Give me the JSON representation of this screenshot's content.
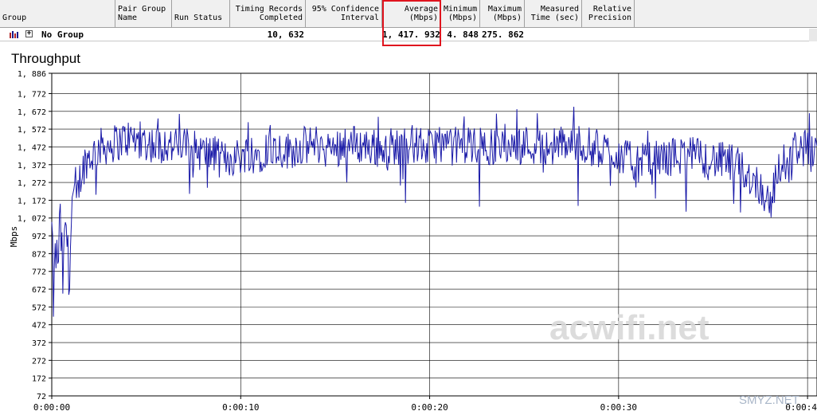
{
  "grid": {
    "headers": [
      {
        "label": "Group",
        "key": "group"
      },
      {
        "label": "Pair Group\nName",
        "key": "pair"
      },
      {
        "label": "Run Status",
        "key": "status"
      },
      {
        "label": "Timing Records\nCompleted",
        "key": "records"
      },
      {
        "label": "95% Confidence\nInterval",
        "key": "ci"
      },
      {
        "label": "Average\n(Mbps)",
        "key": "avg"
      },
      {
        "label": "Minimum\n(Mbps)",
        "key": "min"
      },
      {
        "label": "Maximum\n(Mbps)",
        "key": "max"
      },
      {
        "label": "Measured\nTime (sec)",
        "key": "time"
      },
      {
        "label": "Relative\nPrecision",
        "key": "prec"
      }
    ],
    "row": {
      "group": "No Group",
      "timing_records": "10, 632",
      "average": "1, 417. 932",
      "minimum": "4. 848",
      "maximum": "275. 862"
    },
    "highlight_color": "#e0141e"
  },
  "chart_data": {
    "type": "line",
    "title": "Throughput",
    "xlabel": "",
    "ylabel": "Mbps",
    "ylim": [
      72,
      1886
    ],
    "yticks": [
      "1, 886",
      "1, 772",
      "1, 672",
      "1, 572",
      "1, 472",
      "1, 372",
      "1, 272",
      "1, 172",
      "1, 072",
      "972",
      "872",
      "772",
      "672",
      "572",
      "472",
      "372",
      "272",
      "172",
      "72"
    ],
    "ytick_values": [
      1886,
      1772,
      1672,
      1572,
      1472,
      1372,
      1272,
      1172,
      1072,
      972,
      872,
      772,
      672,
      572,
      472,
      372,
      272,
      172,
      72
    ],
    "xticks": [
      "0:00:00",
      "0:00:10",
      "0:00:20",
      "0:00:30",
      "0:00:4"
    ],
    "xtick_values": [
      0,
      10,
      20,
      30,
      40
    ],
    "xlim": [
      0,
      40.5
    ],
    "grid": true,
    "series_color": "#1a1aa8",
    "series": [
      {
        "x": [
          0,
          0.1,
          0.2,
          0.3,
          0.45,
          0.6,
          0.75,
          0.9,
          1.1,
          1.3,
          1.5,
          1.8,
          2.1,
          2.5,
          3,
          3.5,
          4,
          4.5,
          5,
          5.5,
          6,
          6.5,
          7,
          7.5,
          8,
          8.5,
          9,
          9.5,
          10,
          10.5,
          11,
          11.5,
          12,
          12.5,
          13,
          13.5,
          14,
          14.5,
          15,
          15.5,
          16,
          16.5,
          17,
          17.5,
          18,
          18.5,
          19,
          19.5,
          20,
          20.5,
          21,
          21.5,
          22,
          22.5,
          23,
          23.5,
          24,
          24.5,
          25,
          25.5,
          26,
          26.5,
          27,
          27.5,
          28,
          28.5,
          29,
          29.5,
          30,
          30.5,
          31,
          31.5,
          32,
          32.5,
          33,
          33.5,
          34,
          34.5,
          35,
          35.5,
          36,
          36.5,
          37,
          37.5,
          38,
          38.5,
          39,
          39.5,
          40,
          40.5
        ],
        "y": [
          1000,
          580,
          900,
          800,
          1050,
          700,
          1100,
          720,
          1200,
          1150,
          1300,
          1400,
          1420,
          1470,
          1480,
          1500,
          1520,
          1510,
          1500,
          1480,
          1490,
          1470,
          1480,
          1460,
          1440,
          1430,
          1400,
          1410,
          1420,
          1450,
          1430,
          1480,
          1460,
          1450,
          1470,
          1480,
          1490,
          1470,
          1460,
          1500,
          1490,
          1480,
          1470,
          1460,
          1480,
          1470,
          1490,
          1480,
          1460,
          1500,
          1470,
          1480,
          1490,
          1470,
          1480,
          1460,
          1500,
          1470,
          1490,
          1480,
          1460,
          1480,
          1490,
          1500,
          1480,
          1470,
          1460,
          1450,
          1430,
          1400,
          1380,
          1390,
          1400,
          1410,
          1420,
          1430,
          1420,
          1410,
          1400,
          1390,
          1380,
          1350,
          1300,
          1250,
          1150,
          1350,
          1420,
          1480,
          1460,
          1470
        ]
      }
    ]
  },
  "watermarks": {
    "main": "acwifi.net",
    "corner": "SMYZ.NET"
  }
}
